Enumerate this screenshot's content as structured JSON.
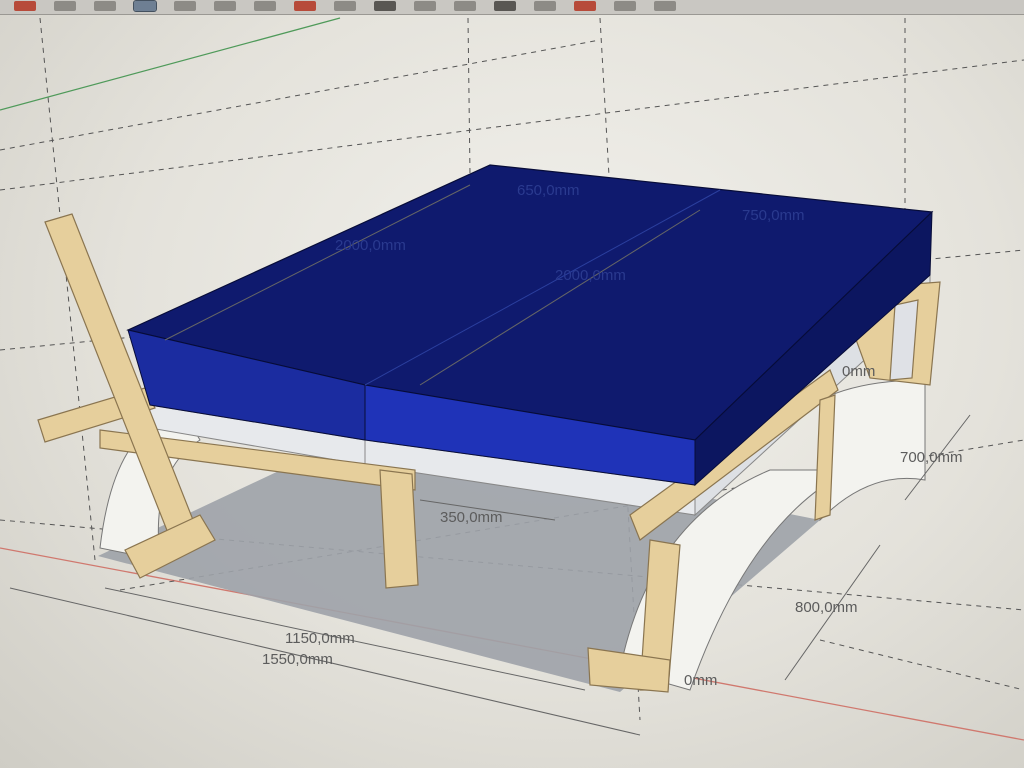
{
  "toolbar": {
    "tools": [
      "select-tool",
      "eraser-tool",
      "paint-tool",
      "line-tool",
      "arc-tool",
      "rectangle-tool",
      "pushpull-tool",
      "move-tool",
      "rotate-tool",
      "scale-tool",
      "offset-tool",
      "tape-tool",
      "dimension-tool",
      "text-tool",
      "orbit-tool",
      "pan-tool",
      "zoom-tool"
    ]
  },
  "colors": {
    "mattress": "#0f1a6e",
    "mattress_side": "#1b2ca0",
    "wood": "#e6cf9c",
    "arch": "#f3f3ef"
  },
  "dimensions": {
    "mattress_width_a": "650,0mm",
    "mattress_width_b": "750,0mm",
    "mattress_length_a": "2000,0mm",
    "mattress_length_b": "2000,0mm",
    "height_a": "700,0mm",
    "height_b": "800,0mm",
    "leg_spacing": "350,0mm",
    "base_inner": "1150,0mm",
    "base_outer": "1550,0mm",
    "partial_mm_a": "0mm",
    "partial_mm_b": "0mm"
  }
}
